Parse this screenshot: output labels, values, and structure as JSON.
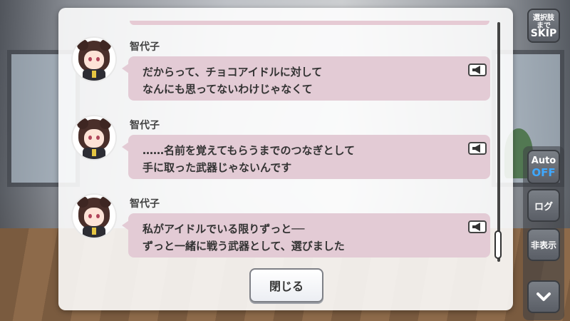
{
  "log": {
    "entries": [
      {
        "speaker": "智代子",
        "line1": "だからって、チョコアイドルに対して",
        "line2": "なんにも思ってないわけじゃなくて"
      },
      {
        "speaker": "智代子",
        "line1": "……名前を覚えてもらうまでのつなぎとして",
        "line2": "手に取った武器じゃないんです"
      },
      {
        "speaker": "智代子",
        "line1": "私がアイドルでいる限りずっと──",
        "line2": "ずっと一緒に戦う武器として、選びました"
      }
    ],
    "close_label": "閉じる"
  },
  "side_buttons": {
    "skip_line1": "選択肢",
    "skip_line2": "まで",
    "skip_line3": "SKIP",
    "auto_line1": "Auto",
    "auto_line2": "OFF",
    "log_label": "ログ",
    "hide_label": "非表示"
  },
  "icons": {
    "voice": "speaker-icon",
    "down": "chevron-down-icon"
  },
  "colors": {
    "bubble": "#e3cbd5",
    "auto_off": "#3ea8ff"
  }
}
